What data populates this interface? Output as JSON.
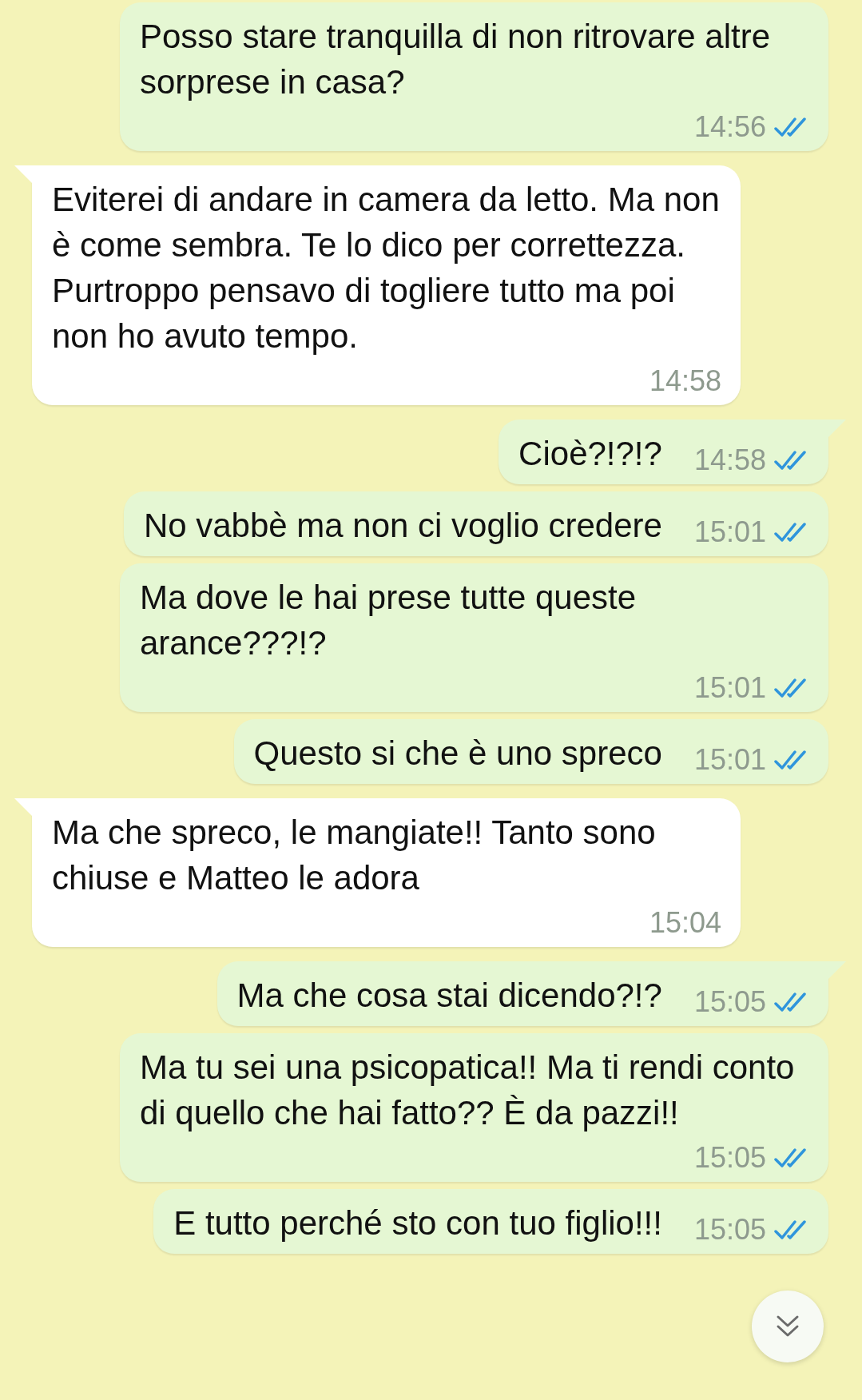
{
  "messages": [
    {
      "kind": "sent",
      "tail": false,
      "text": "Posso stare tranquilla di non ritrovare altre sorprese in casa?",
      "time": "14:56",
      "read": true
    },
    {
      "kind": "received",
      "tail": true,
      "text": "Eviterei di andare in camera da letto. Ma non è come sembra. Te lo dico per correttezza. Purtroppo pensavo di togliere tutto ma poi non ho avuto tempo.",
      "time": "14:58"
    },
    {
      "kind": "sent",
      "tail": true,
      "text": "Cioè?!?!?",
      "time": "14:58",
      "read": true
    },
    {
      "kind": "sent",
      "tail": false,
      "text": "No vabbè ma non ci voglio credere",
      "time": "15:01",
      "read": true
    },
    {
      "kind": "sent",
      "tail": false,
      "text": "Ma dove le hai prese tutte queste arance???!?",
      "time": "15:01",
      "read": true
    },
    {
      "kind": "sent",
      "tail": false,
      "text": "Questo si che è uno spreco",
      "time": "15:01",
      "read": true
    },
    {
      "kind": "received",
      "tail": true,
      "text": "Ma che spreco, le mangiate!! Tanto sono chiuse e Matteo le adora",
      "time": "15:04"
    },
    {
      "kind": "sent",
      "tail": true,
      "text": "Ma che cosa stai dicendo?!?",
      "time": "15:05",
      "read": true
    },
    {
      "kind": "sent",
      "tail": false,
      "text": "Ma tu sei una psicopatica!! Ma ti rendi conto di quello che hai fatto?? È da pazzi!!",
      "time": "15:05",
      "read": true
    },
    {
      "kind": "sent",
      "tail": false,
      "text": "E tutto perché sto con tuo figlio!!!",
      "time": "15:05",
      "read": true
    }
  ]
}
